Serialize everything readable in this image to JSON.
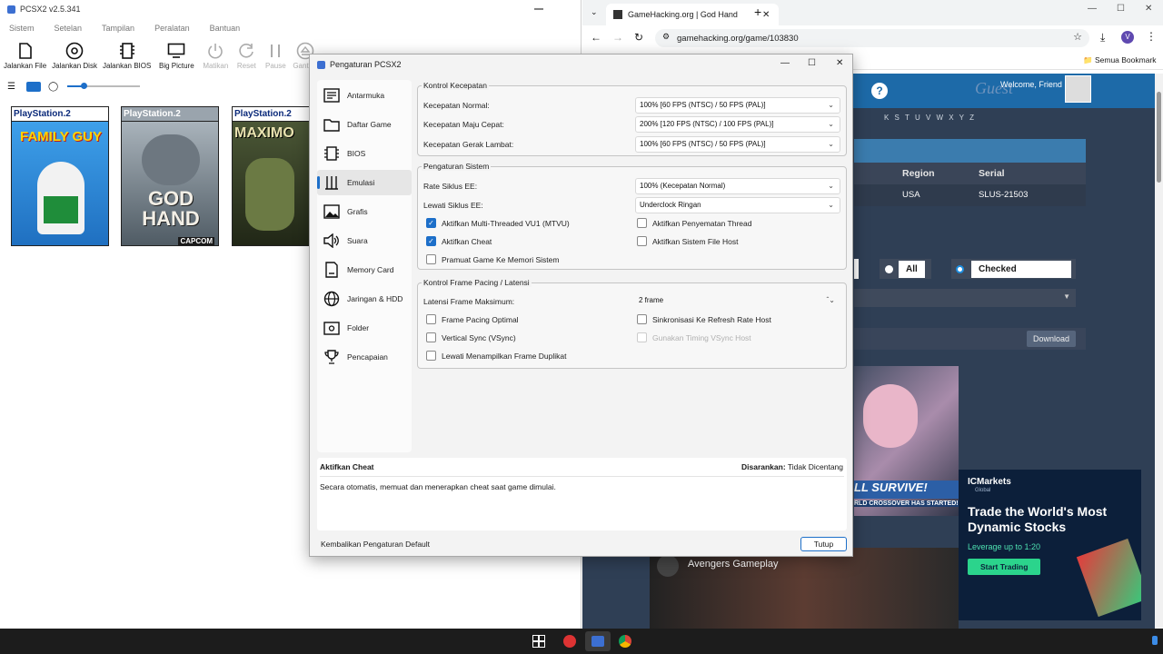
{
  "pcsx": {
    "title": "PCSX2 v2.5.341",
    "menu": [
      "Sistem",
      "Setelan",
      "Tampilan",
      "Peralatan",
      "Bantuan"
    ],
    "toolbar": [
      {
        "label": "Jalankan File",
        "icon": "file-icon",
        "enabled": true
      },
      {
        "label": "Jalankan Disk",
        "icon": "disc-icon",
        "enabled": true
      },
      {
        "label": "Jalankan BIOS",
        "icon": "chip-icon",
        "enabled": true
      },
      {
        "label": "Big Picture",
        "icon": "monitor-icon",
        "enabled": true
      },
      {
        "label": "Matikan",
        "icon": "power-icon",
        "enabled": false
      },
      {
        "label": "Reset",
        "icon": "reset-icon",
        "enabled": false
      },
      {
        "label": "Pause",
        "icon": "pause-icon",
        "enabled": false
      },
      {
        "label": "Ganti D",
        "icon": "eject-icon",
        "enabled": false
      }
    ],
    "covers": [
      {
        "brand": "PlayStation.2",
        "title": "FAMILY GUY",
        "bg": "#2f8ad8"
      },
      {
        "brand": "PlayStation.2",
        "title": "GOD HAND",
        "bg": "#5d6a73",
        "publisher": "CAPCOM"
      },
      {
        "brand": "PlayStation.2",
        "title": "MAXIMO",
        "bg": "#2f3a24"
      }
    ]
  },
  "chrome": {
    "tab_title": "GameHacking.org | God Hand",
    "url": "gamehacking.org/game/103830",
    "bookmarks": "Semua Bookmark",
    "profile_initial": "V",
    "site": {
      "welcome": "Welcome, Friend",
      "guest": "Guest",
      "letters": "K  S  T  U  V  W  X  Y  Z",
      "col_region": "Region",
      "col_serial": "Serial",
      "region": "USA",
      "serial": "SLUS-21503",
      "filter_all": "All",
      "filter_checked": "Checked",
      "download": "Download",
      "ad_banner": "LL SURVIVE!",
      "ad_sub": "RLD CROSSOVER HAS STARTED!",
      "ad_brand": "ICMarkets",
      "ad_brand_sub": "Global",
      "ad_title": "Trade the World's Most Dynamic Stocks",
      "ad_leverage": "Leverage up to 1:20",
      "ad_cta": "Start Trading",
      "video_title": "Avengers Gameplay"
    }
  },
  "dialog": {
    "title": "Pengaturan PCSX2",
    "nav": [
      {
        "label": "Antarmuka",
        "icon": "interface-icon"
      },
      {
        "label": "Daftar Game",
        "icon": "folder-list-icon"
      },
      {
        "label": "BIOS",
        "icon": "chip-icon"
      },
      {
        "label": "Emulasi",
        "icon": "emulation-icon",
        "selected": true
      },
      {
        "label": "Grafis",
        "icon": "image-icon"
      },
      {
        "label": "Suara",
        "icon": "speaker-icon"
      },
      {
        "label": "Memory Card",
        "icon": "memory-card-icon"
      },
      {
        "label": "Jaringan & HDD",
        "icon": "globe-icon"
      },
      {
        "label": "Folder",
        "icon": "folder-icon"
      },
      {
        "label": "Pencapaian",
        "icon": "trophy-icon"
      }
    ],
    "speed": {
      "title": "Kontrol Kecepatan",
      "normal_label": "Kecepatan Normal:",
      "normal_value": "100% [60 FPS (NTSC) / 50 FPS (PAL)]",
      "fast_label": "Kecepatan Maju Cepat:",
      "fast_value": "200% [120 FPS (NTSC) / 100 FPS (PAL)]",
      "slow_label": "Kecepatan Gerak Lambat:",
      "slow_value": "100% [60 FPS (NTSC) / 50 FPS (PAL)]"
    },
    "system": {
      "title": "Pengaturan Sistem",
      "ee_rate_label": "Rate Siklus EE:",
      "ee_rate_value": "100% (Kecepatan Normal)",
      "ee_skip_label": "Lewati Siklus EE:",
      "ee_skip_value": "Underclock Ringan",
      "mtvu": "Aktifkan Multi-Threaded VU1 (MTVU)",
      "thread_pin": "Aktifkan Penyematan Thread",
      "cheats": "Aktifkan Cheat",
      "host_fs": "Aktifkan Sistem File Host",
      "preload": "Pramuat Game Ke Memori Sistem"
    },
    "frame": {
      "title": "Kontrol Frame Pacing / Latensi",
      "latency_label": "Latensi Frame Maksimum:",
      "latency_value": "2 frame",
      "optimal": "Frame Pacing Optimal",
      "sync_host": "Sinkronisasi Ke Refresh Rate Host",
      "vsync": "Vertical Sync (VSync)",
      "host_timing": "Gunakan Timing VSync Host",
      "skip_dup": "Lewati Menampilkan Frame Duplikat"
    },
    "desc": {
      "title": "Aktifkan Cheat",
      "recommended_label": "Disarankan:",
      "recommended_value": "Tidak Dicentang",
      "text": "Secara otomatis, memuat dan menerapkan cheat saat game dimulai."
    },
    "reset_button": "Kembalikan Pengaturan Default",
    "close_button": "Tutup"
  }
}
